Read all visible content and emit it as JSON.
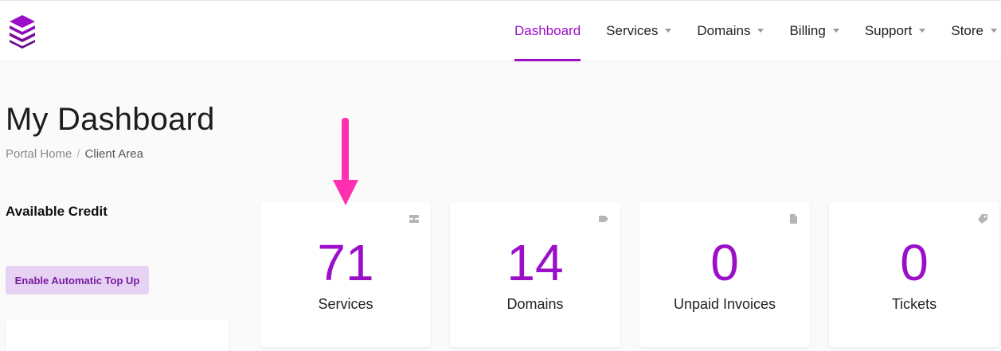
{
  "header": {
    "nav": [
      {
        "label": "Dashboard",
        "active": true
      },
      {
        "label": "Services",
        "dropdown": true
      },
      {
        "label": "Domains",
        "dropdown": true
      },
      {
        "label": "Billing",
        "dropdown": true
      },
      {
        "label": "Support",
        "dropdown": true
      },
      {
        "label": "Store",
        "dropdown": true
      }
    ]
  },
  "page": {
    "title": "My Dashboard",
    "breadcrumb": [
      "Portal Home",
      "Client Area"
    ]
  },
  "sidebar": {
    "credit_title": "Available Credit",
    "topup_button": "Enable Automatic Top Up"
  },
  "tiles": [
    {
      "number": "71",
      "label": "Services",
      "icon": "server-icon"
    },
    {
      "number": "14",
      "label": "Domains",
      "icon": "tag-icon"
    },
    {
      "number": "0",
      "label": "Unpaid Invoices",
      "icon": "document-icon"
    },
    {
      "number": "0",
      "label": "Tickets",
      "icon": "ticket-icon"
    }
  ],
  "colors": {
    "accent": "#9c0fc9",
    "annotation_arrow": "#ff2fb0",
    "button_bg": "#e6d3f4"
  }
}
